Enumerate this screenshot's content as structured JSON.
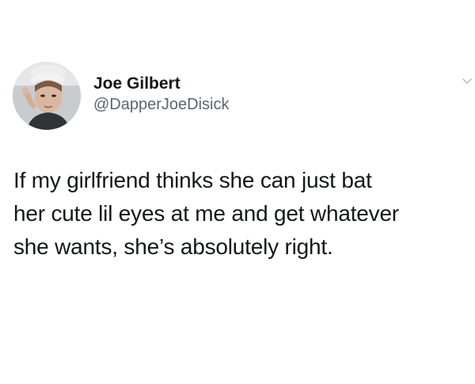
{
  "tweet": {
    "author": {
      "display_name": "Joe Gilbert",
      "handle": "@DapperJoeDisick",
      "avatar_icon": "profile-photo"
    },
    "text_lines": [
      "If my girlfriend thinks she can just bat",
      "her cute lil eyes at me and get whatever",
      "she wants, she’s absolutely right."
    ],
    "menu_icon": "chevron-down-icon"
  },
  "colors": {
    "background": "#ffffff",
    "primary_text": "#14171a",
    "secondary_text": "#5b6670",
    "chevron": "#aab8c2"
  }
}
